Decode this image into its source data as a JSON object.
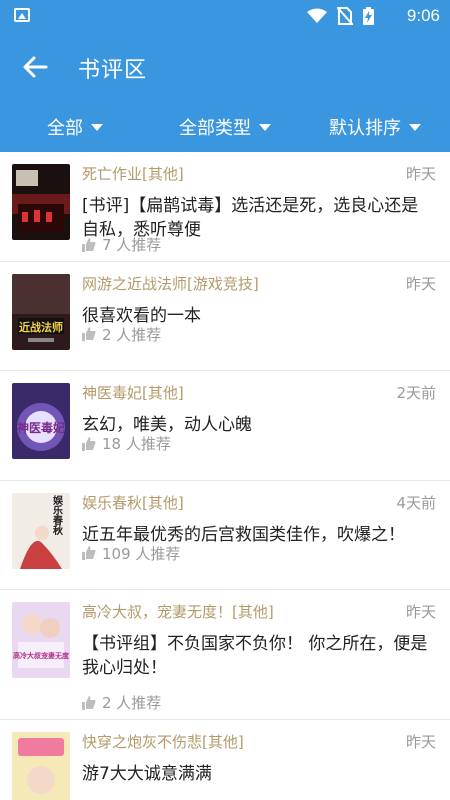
{
  "status": {
    "time": "9:06"
  },
  "header": {
    "title": "书评区"
  },
  "filters": [
    {
      "label": "全部"
    },
    {
      "label": "全部类型"
    },
    {
      "label": "默认排序"
    }
  ],
  "colors": {
    "primary": "#3a96de",
    "book_title": "#b39a6a",
    "muted": "#9a9a9a"
  },
  "reviews": [
    {
      "book": "死亡作业[其他]",
      "date": "昨天",
      "text": "[书评]【扁鹊试毒】选活还是死，选良心还是自私，悉听尊便",
      "likes": "7 人推荐",
      "cover_text": ""
    },
    {
      "book": "网游之近战法师[游戏竞技]",
      "date": "昨天",
      "text": "很喜欢看的一本",
      "likes": "2 人推荐",
      "cover_text": "近战法师"
    },
    {
      "book": "神医毒妃[其他]",
      "date": "2天前",
      "text": "玄幻，唯美，动人心魄",
      "likes": "18 人推荐",
      "cover_text": "神医毒妃"
    },
    {
      "book": "娱乐春秋[其他]",
      "date": "4天前",
      "text": "近五年最优秀的后宫救国类佳作，吹爆之！",
      "likes": "109 人推荐",
      "cover_text": "娱乐春秋"
    },
    {
      "book": "高冷大叔，宠妻无度！[其他]",
      "date": "昨天",
      "text": "【书评组】不负国家不负你！ 你之所在，便是我心归处！",
      "likes": "2 人推荐",
      "cover_text": "高冷大叔宠妻无度"
    },
    {
      "book": "快穿之炮灰不伤悲[其他]",
      "date": "昨天",
      "text": "游7大大诚意满满",
      "likes": "",
      "cover_text": ""
    }
  ]
}
